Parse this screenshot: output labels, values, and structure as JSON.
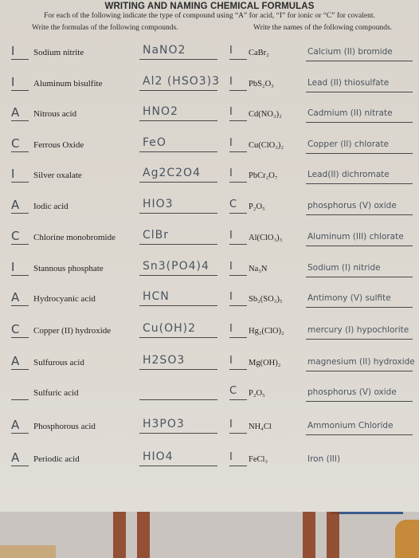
{
  "worksheet": {
    "title": "WRITING AND NAMING CHEMICAL FORMULAS",
    "instructions": "For each of the following indicate the type of compound using “A” for acid, “I” for ionic or “C” for covalent.",
    "left_subheading": "Write the formulas of the following compounds.",
    "right_subheading": "Write the names of the following compounds."
  },
  "rows": [
    {
      "type": "I",
      "name": "Sodium nitrite",
      "formula_answer": "NaNO2",
      "type2": "I",
      "formula": "CaBr₂",
      "name_answer": "Calcium (II) bromide"
    },
    {
      "type": "I",
      "name": "Aluminum bisulfite",
      "formula_answer": "Al2 (HSO3)3",
      "type2": "I",
      "formula": "PbS₂O₃",
      "name_answer": "Lead (II) thiosulfate"
    },
    {
      "type": "A",
      "name": "Nitrous acid",
      "formula_answer": "HNO2",
      "type2": "I",
      "formula": "Cd(NO₃)₂",
      "name_answer": "Cadmium (II) nitrate"
    },
    {
      "type": "C",
      "name": "Ferrous Oxide",
      "formula_answer": "FeO",
      "type2": "I",
      "formula": "Cu(ClO₃)₂",
      "name_answer": "Copper (II) chlorate"
    },
    {
      "type": "I",
      "name": "Silver oxalate",
      "formula_answer": "Ag2C2O4",
      "type2": "I",
      "formula": "PbCr₂O₇",
      "name_answer": "Lead(II) dichromate"
    },
    {
      "type": "A",
      "name": "Iodic acid",
      "formula_answer": "HIO3",
      "type2": "C",
      "formula": "P₂O₅",
      "name_answer": "phosphorus (V) oxide"
    },
    {
      "type": "C",
      "name": "Chlorine monobromide",
      "formula_answer": "ClBr",
      "type2": "I",
      "formula": "Al(ClO₃)₃",
      "name_answer": "Aluminum (III) chlorate"
    },
    {
      "type": "I",
      "name": "Stannous phosphate",
      "formula_answer": "Sn3(PO4)4",
      "type2": "I",
      "formula": "Na₃N",
      "name_answer": "Sodium (I) nitride"
    },
    {
      "type": "A",
      "name": "Hydrocyanic acid",
      "formula_answer": "HCN",
      "type2": "I",
      "formula": "Sb₂(SO₃)₅",
      "name_answer": "Antimony (V) sulfite"
    },
    {
      "type": "C",
      "name": "Copper (II) hydroxide",
      "formula_answer": "Cu(OH)2",
      "type2": "I",
      "formula": "Hg₂(ClO)₂",
      "name_answer": "mercury (I) hypochlorite"
    },
    {
      "type": "A",
      "name": "Sulfurous acid",
      "formula_answer": "H2SO3",
      "type2": "I",
      "formula": "Mg(OH)₂",
      "name_answer": "magnesium (II) hydroxide"
    },
    {
      "type": "",
      "name": "Sulfuric acid",
      "formula_answer": "",
      "type2": "C",
      "formula": "P₂O₅",
      "name_answer": "phosphorus (V) oxide"
    },
    {
      "type": "A",
      "name": "Phosphorous acid",
      "formula_answer": "H3PO3",
      "type2": "I",
      "formula": "NH₄Cl",
      "name_answer": "Ammonium Chloride"
    },
    {
      "type": "A",
      "name": "Periodic acid",
      "formula_answer": "HIO4",
      "type2": "I",
      "formula": "FeCl₃",
      "name_answer": "Iron (III)"
    }
  ]
}
